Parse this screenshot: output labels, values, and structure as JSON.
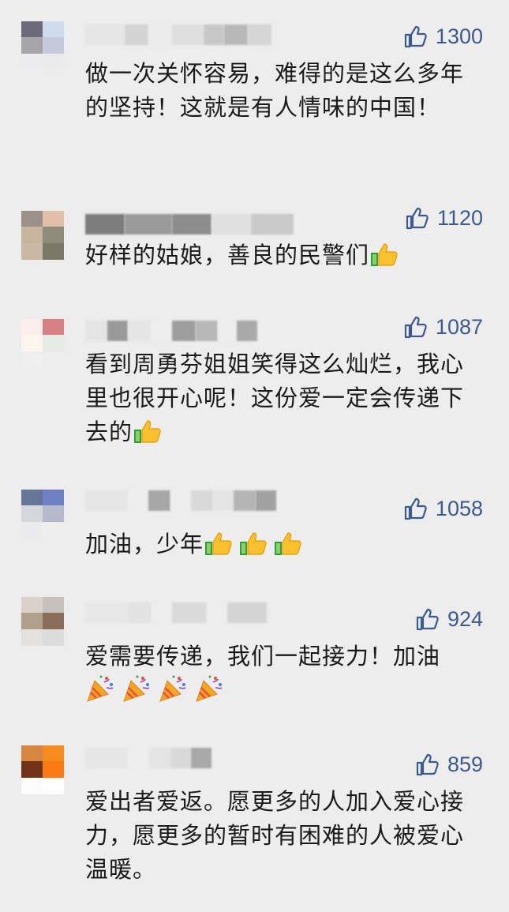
{
  "comments": [
    {
      "likes": "1300",
      "text": "做一次关怀容易，难得的是这么多年的坚持！这就是有人情味的中国！",
      "emoji": "",
      "emoji_count": 0,
      "avatar_colors": [
        "#6d6a7c",
        "#cfdcef",
        "#a6a6a8",
        "#c5c9d9",
        "#ececef",
        "#ebebec"
      ]
    },
    {
      "likes": "1120",
      "text": "好样的姑娘，善良的民警们",
      "emoji": "thumbs-up-emoji",
      "emoji_count": 1,
      "avatar_colors": [
        "#9b908a",
        "#e2bfa8",
        "#c7b49d",
        "#8e8b7a",
        "#ededed",
        "#ededed"
      ]
    },
    {
      "likes": "1087",
      "text": "看到周勇芬姐姐笑得这么灿烂，我心里也很开心呢！这份爱一定会传递下去的",
      "emoji": "thumbs-up-emoji",
      "emoji_count": 1,
      "avatar_colors": [
        "#fbeeed",
        "#d98085",
        "#fbf5ee",
        "#e8ebe5",
        "#ededed",
        "#ededed"
      ]
    },
    {
      "likes": "1058",
      "text": "加油，少年",
      "emoji": "thumbs-up-emoji",
      "emoji_count": 3,
      "avatar_colors": [
        "#67759a",
        "#6f81c4",
        "#d6d7dc",
        "#b6b8cc",
        "#ebebed",
        "#ededed"
      ]
    },
    {
      "likes": "924",
      "text": "爱需要传递，我们一起接力！加油",
      "emoji": "party-popper-emoji",
      "emoji_count": 4,
      "avatar_colors": [
        "#d9d1ca",
        "#c8c0bb",
        "#b0a08b",
        "#8a6e5b",
        "#e4e2e1",
        "#dcdcdc"
      ]
    },
    {
      "likes": "859",
      "text": "爱出者爱返。愿更多的人加入爱心接力，愿更多的暂时有困难的人被爱心温暖。",
      "emoji": "",
      "emoji_count": 0,
      "avatar_colors": [
        "#d58742",
        "#f58d1e",
        "#6f3318",
        "#fb7a13",
        "#fcfcfc",
        "#fefefe"
      ]
    }
  ],
  "colors": {
    "background": "#ededed",
    "like_count": "#3d5a8f",
    "text": "#1a1a1a"
  }
}
